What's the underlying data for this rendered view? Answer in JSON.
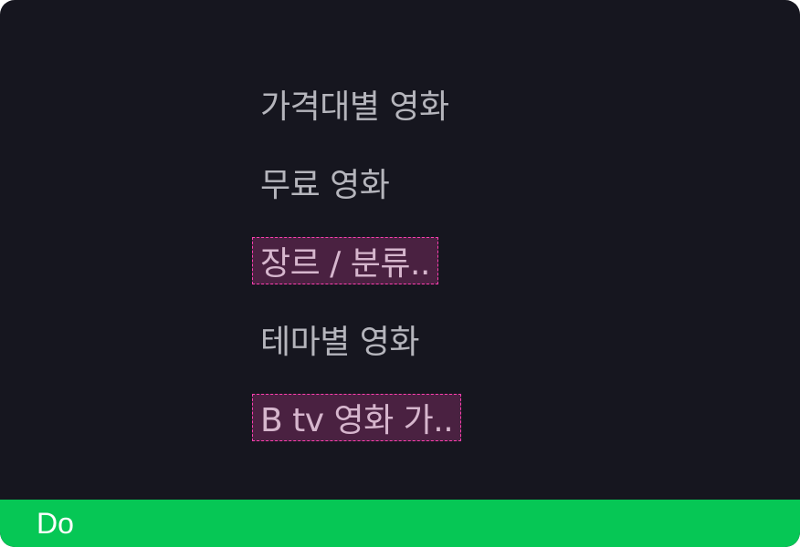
{
  "menu": {
    "items": [
      {
        "label": "가격대별 영화",
        "highlighted": false
      },
      {
        "label": "무료 영화",
        "highlighted": false
      },
      {
        "label": "장르 / 분류..",
        "highlighted": true
      },
      {
        "label": "테마별 영화",
        "highlighted": false
      },
      {
        "label": "B tv 영화 가..",
        "highlighted": true
      }
    ]
  },
  "footer": {
    "label": "Do",
    "color": "#06c755"
  },
  "colors": {
    "background": "#16161f",
    "text": "#b5b5bc",
    "highlight_fill": "#4a2141",
    "highlight_border": "#ff3fb0"
  }
}
